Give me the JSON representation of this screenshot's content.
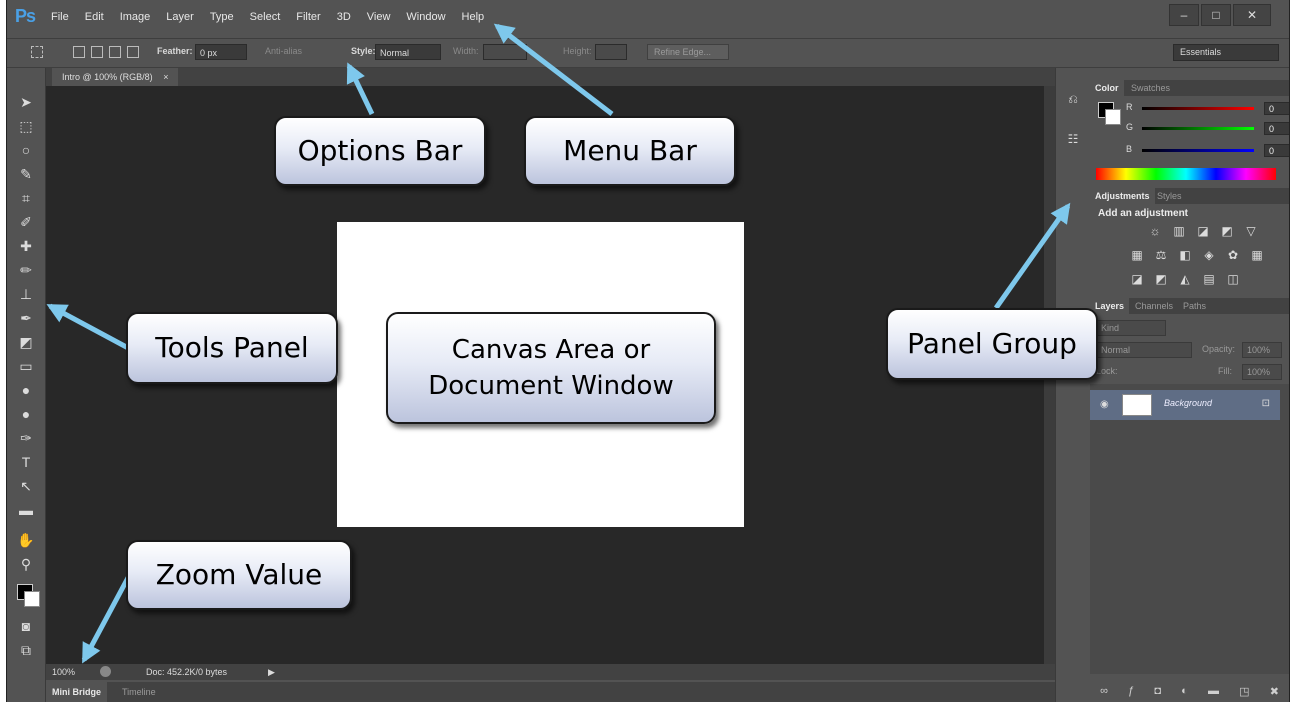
{
  "app": {
    "logo": "Ps",
    "menu": [
      "File",
      "Edit",
      "Image",
      "Layer",
      "Type",
      "Select",
      "Filter",
      "3D",
      "View",
      "Window",
      "Help"
    ],
    "window_controls": [
      "–",
      "□",
      "✕"
    ]
  },
  "options_bar": {
    "feather_label": "Feather:",
    "feather_value": "0 px",
    "antialias_label": "Anti-alias",
    "style_label": "Style:",
    "style_value": "Normal",
    "width_label": "Width:",
    "height_label": "Height:",
    "refine_edge": "Refine Edge...",
    "workspace": "Essentials"
  },
  "document": {
    "tab_title": "Intro @ 100% (RGB/8)",
    "tab_close": "×",
    "zoom": "100%",
    "doc_info": "Doc: 452.2K/0 bytes",
    "status_arrow": "▶",
    "bottom_tabs": [
      "Mini Bridge",
      "Timeline"
    ]
  },
  "panels": {
    "color_tabs": [
      "Color",
      "Swatches"
    ],
    "channels": [
      {
        "label": "R",
        "value": "0",
        "color": "#cc2222"
      },
      {
        "label": "G",
        "value": "0",
        "color": "#22aa22"
      },
      {
        "label": "B",
        "value": "0",
        "color": "#2244cc"
      }
    ],
    "adjust_tabs": [
      "Adjustments",
      "Styles"
    ],
    "adjust_title": "Add an adjustment",
    "layers_tabs": [
      "Layers",
      "Channels",
      "Paths"
    ],
    "kind": "Kind",
    "blend_mode": "Normal",
    "opacity_label": "Opacity:",
    "opacity_value": "100%",
    "lock_label": "Lock:",
    "fill_label": "Fill:",
    "fill_value": "100%",
    "layer_name": "Background"
  },
  "callouts": {
    "options_bar": "Options Bar",
    "menu_bar": "Menu Bar",
    "tools_panel": "Tools Panel",
    "canvas_line1": "Canvas Area or",
    "canvas_line2": "Document Window",
    "panel_group": "Panel Group",
    "zoom_value": "Zoom Value"
  },
  "colors": {
    "arrow": "#7ec8ec",
    "callout_border": "#1a1a1a",
    "canvas_bg": "#282828",
    "ui_gray": "#535353"
  }
}
